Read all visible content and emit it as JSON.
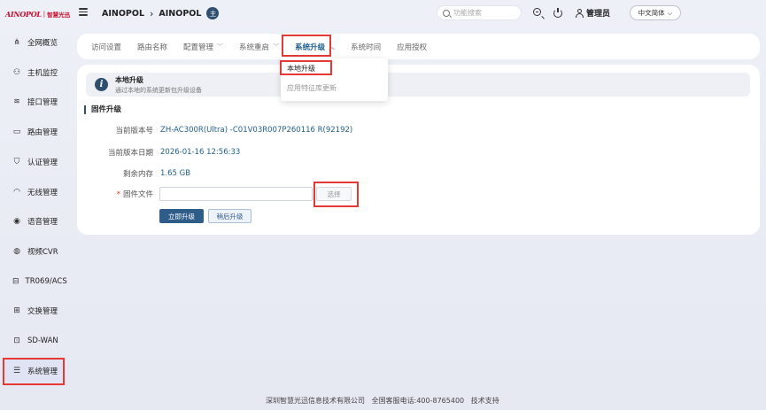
{
  "logo": {
    "brand": "AINOPOL",
    "separator": "|",
    "subtitle": "智慧光迅"
  },
  "header": {
    "breadcrumb": [
      "AINOPOL",
      "AINOPOL"
    ],
    "avatar_label": "主",
    "search": {
      "placeholder": "功能搜索"
    },
    "user_label": "管理员",
    "language": "中文简体"
  },
  "sidebar": {
    "items": [
      {
        "label": "全网概览",
        "icon": "network-topology-icon"
      },
      {
        "label": "主机监控",
        "icon": "user-icon"
      },
      {
        "label": "接口管理",
        "icon": "stack-icon"
      },
      {
        "label": "路由管理",
        "icon": "monitor-icon"
      },
      {
        "label": "认证管理",
        "icon": "shield-icon"
      },
      {
        "label": "无线管理",
        "icon": "wifi-icon"
      },
      {
        "label": "语音管理",
        "icon": "sip-icon"
      },
      {
        "label": "视频CVR",
        "icon": "camera-icon"
      },
      {
        "label": "TR069/ACS",
        "icon": "router-icon"
      },
      {
        "label": "交换管理",
        "icon": "switch-icon"
      },
      {
        "label": "SD-WAN",
        "icon": "sdwan-icon"
      },
      {
        "label": "系统管理",
        "icon": "sliders-icon"
      }
    ],
    "active_index": 11
  },
  "tabs": [
    {
      "label": "访问设置",
      "dropdown": false
    },
    {
      "label": "路由名称",
      "dropdown": false
    },
    {
      "label": "配置管理",
      "dropdown": true
    },
    {
      "label": "系统重启",
      "dropdown": true
    },
    {
      "label": "系统升级",
      "dropdown": true
    },
    {
      "label": "系统时间",
      "dropdown": false
    },
    {
      "label": "应用授权",
      "dropdown": false
    }
  ],
  "dropdown_menu": {
    "options": [
      "本地升级",
      "应用特征库更新"
    ]
  },
  "notice": {
    "title": "本地升级",
    "text": "通过本地的系统更新包升级设备"
  },
  "firmware": {
    "section_title": "固件升级",
    "version_label": "当前版本号",
    "version_value": "ZH-AC300R(Ultra) -C01V03R007P260116 R(92192)",
    "date_label": "当前版本日期",
    "date_value": "2026-01-16 12:56:33",
    "memory_label": "剩余内存",
    "memory_value": "1.65 GB",
    "required_mark": "*",
    "file_label": "固件文件",
    "choose_label": "选择",
    "upgrade_now": "立即升级",
    "upgrade_later": "稍后升级"
  },
  "footer": {
    "company": "深圳智慧光迅信息技术有限公司",
    "hotline": "全国客服电话:400-8765400",
    "support": "技术支持"
  },
  "colors": {
    "accent": "#2f5d8a",
    "highlight": "#e53935"
  }
}
